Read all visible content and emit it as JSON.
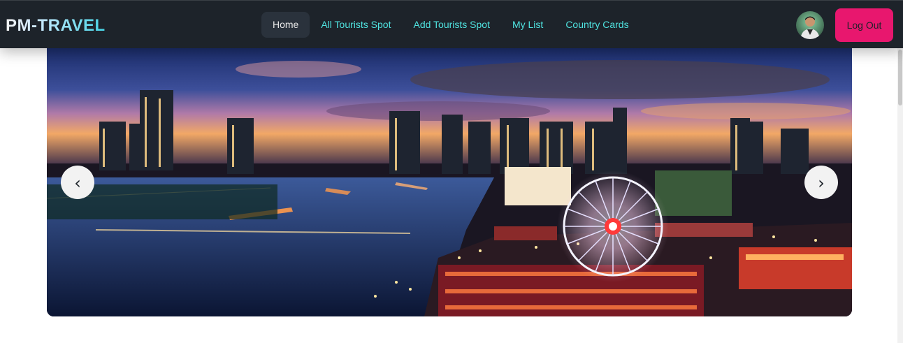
{
  "brand": {
    "name": "PM-TRAVEL"
  },
  "nav": {
    "items": [
      {
        "label": "Home",
        "active": true
      },
      {
        "label": "All Tourists Spot",
        "active": false
      },
      {
        "label": "Add Tourists Spot",
        "active": false
      },
      {
        "label": "My List",
        "active": false
      },
      {
        "label": "Country Cards",
        "active": false
      }
    ]
  },
  "user": {
    "logout_label": "Log Out"
  },
  "carousel": {
    "prev_symbol": "‹",
    "next_symbol": "›"
  },
  "colors": {
    "navbar_bg": "#1d232a",
    "nav_link": "#4fe3e0",
    "logout_bg": "#e8176e"
  }
}
